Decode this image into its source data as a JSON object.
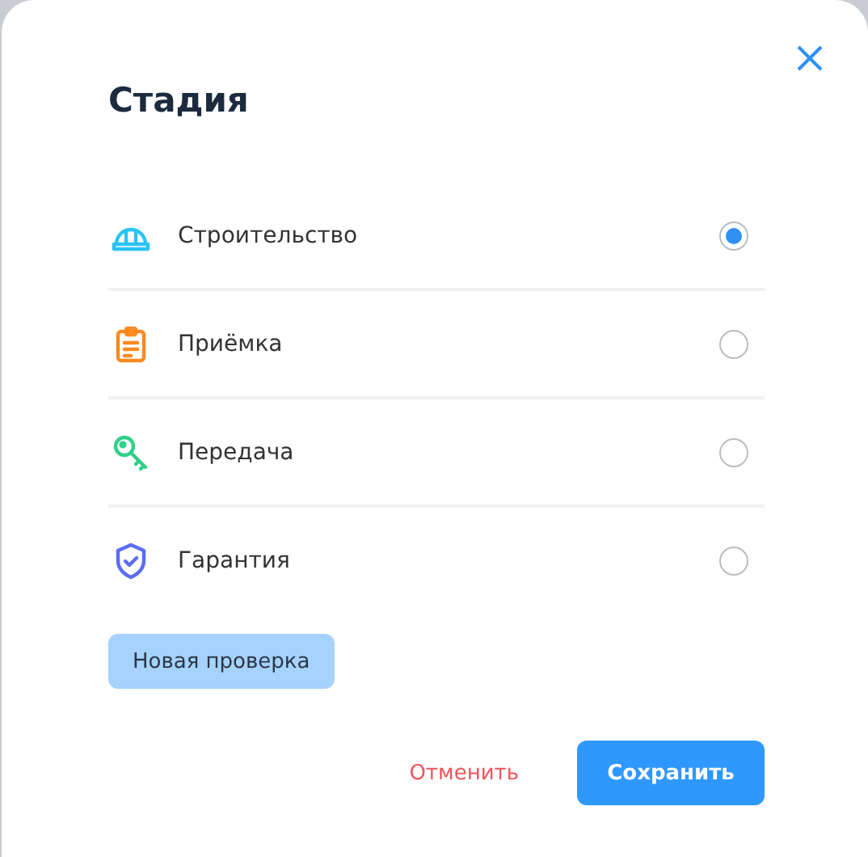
{
  "dialog": {
    "title": "Стадия"
  },
  "options": [
    {
      "label": "Строительство",
      "kind": "helmet",
      "color": "#29c4f6",
      "selected": true
    },
    {
      "label": "Приёмка",
      "kind": "clipboard",
      "color": "#ff8a1f",
      "selected": false
    },
    {
      "label": "Передача",
      "kind": "key",
      "color": "#2fd088",
      "selected": false
    },
    {
      "label": "Гарантия",
      "kind": "shield",
      "color": "#5b6cf5",
      "selected": false
    }
  ],
  "new_check_button": "Новая проверка",
  "cancel_button": "Отменить",
  "save_button": "Сохранить"
}
